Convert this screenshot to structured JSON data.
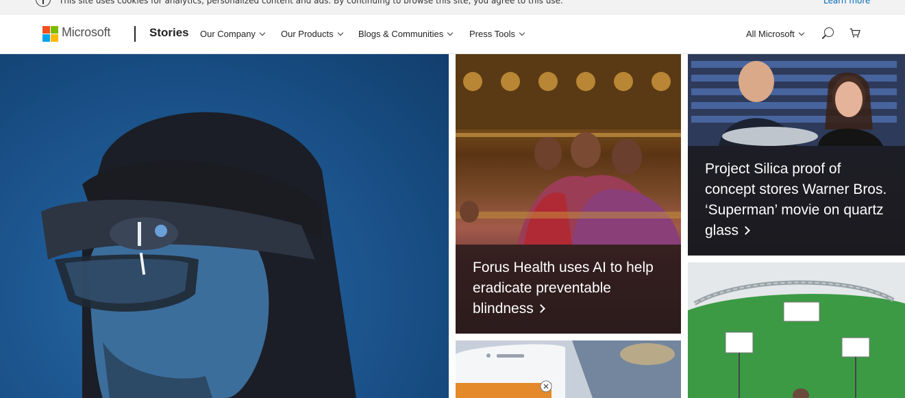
{
  "cookie_banner": {
    "text": "This site uses cookies for analytics, personalized content and ads. By continuing to browse this site, you agree to this use.",
    "link": "Learn more"
  },
  "header": {
    "brand": "Microsoft",
    "section": "Stories",
    "nav": [
      "Our Company",
      "Our Products",
      "Blogs & Communities",
      "Press Tools"
    ],
    "all_microsoft": "All Microsoft"
  },
  "tiles": {
    "forus": {
      "title": "Forus Health uses AI to help eradicate preventable blindness"
    },
    "silica": {
      "title": "Project Silica proof of concept stores Warner Bros. ‘Superman’ movie on quartz glass"
    }
  },
  "colors": {
    "brand_red": "#f25022",
    "brand_green": "#7fba00",
    "brand_blue": "#00a4ef",
    "brand_yellow": "#ffb900",
    "link": "#0067b8"
  }
}
